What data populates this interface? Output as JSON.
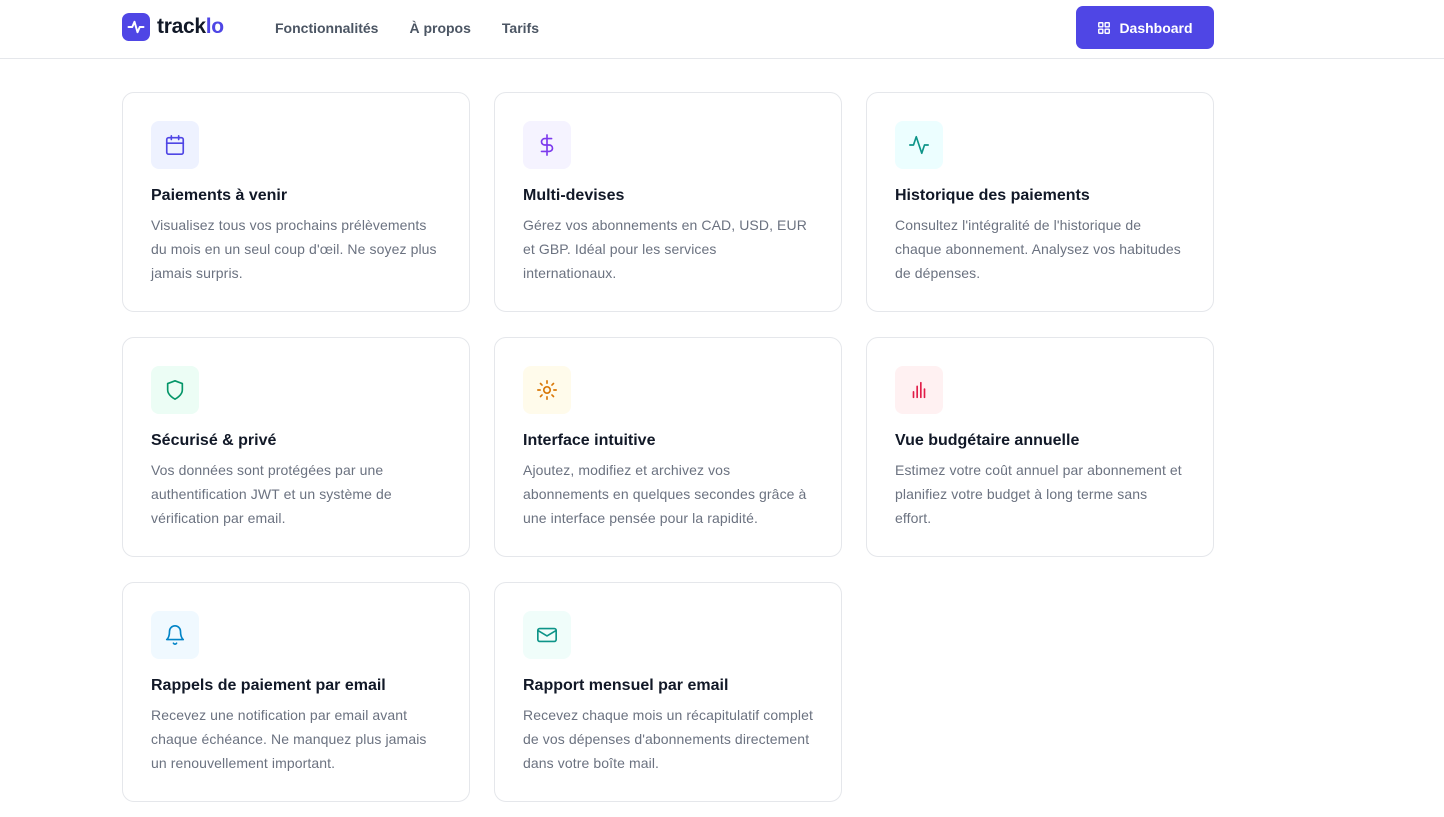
{
  "brand": {
    "name_a": "track",
    "name_b": "lo",
    "logo_icon": "pulse-icon",
    "accent": "#4f46e5"
  },
  "nav": {
    "links": [
      "Fonctionnalités",
      "À propos",
      "Tarifs"
    ],
    "dashboard_label": "Dashboard",
    "dashboard_icon": "grid-icon"
  },
  "features": [
    {
      "title": "Paiements à venir",
      "desc": "Visualisez tous vos prochains prélèvements du mois en un seul coup d'œil. Ne soyez plus jamais surpris.",
      "icon": "calendar-icon",
      "icon_color": "#4f46e5",
      "icon_bg": "#eef2ff"
    },
    {
      "title": "Multi-devises",
      "desc": "Gérez vos abonnements en CAD, USD, EUR et GBP. Idéal pour les services internationaux.",
      "icon": "dollar-icon",
      "icon_color": "#7c3aed",
      "icon_bg": "#f5f3ff"
    },
    {
      "title": "Historique des paiements",
      "desc": "Consultez l'intégralité de l'historique de chaque abonnement. Analysez vos habitudes de dépenses.",
      "icon": "activity-icon",
      "icon_color": "#0d9488",
      "icon_bg": "#ecfeff"
    },
    {
      "title": "Sécurisé & privé",
      "desc": "Vos données sont protégées par une authentification JWT et un système de vérification par email.",
      "icon": "shield-icon",
      "icon_color": "#059669",
      "icon_bg": "#ecfdf5"
    },
    {
      "title": "Interface intuitive",
      "desc": "Ajoutez, modifiez et archivez vos abonnements en quelques secondes grâce à une interface pensée pour la rapidité.",
      "icon": "sun-icon",
      "icon_color": "#d97706",
      "icon_bg": "#fffbeb"
    },
    {
      "title": "Vue budgétaire annuelle",
      "desc": "Estimez votre coût annuel par abonnement et planifiez votre budget à long terme sans effort.",
      "icon": "bar-chart-icon",
      "icon_color": "#e11d48",
      "icon_bg": "#fff1f2"
    },
    {
      "title": "Rappels de paiement par email",
      "desc": "Recevez une notification par email avant chaque échéance. Ne manquez plus jamais un renouvellement important.",
      "icon": "bell-icon",
      "icon_color": "#0284c7",
      "icon_bg": "#f0f9ff"
    },
    {
      "title": "Rapport mensuel par email",
      "desc": "Recevez chaque mois un récapitulatif complet de vos dépenses d'abonnements directement dans votre boîte mail.",
      "icon": "mail-icon",
      "icon_color": "#0d9488",
      "icon_bg": "#f0fdfa"
    }
  ]
}
